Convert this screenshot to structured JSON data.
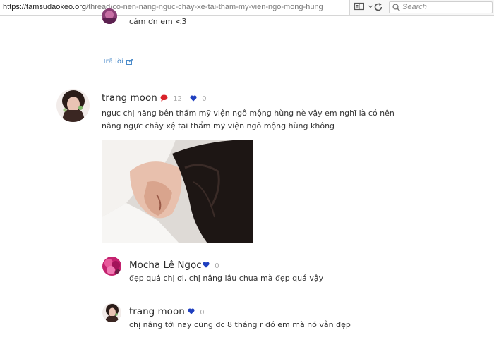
{
  "browser": {
    "url_host": "https://tamsudaokeo.org",
    "url_path": "/thread/co-nen-nang-nguc-chay-xe-tai-tham-my-vien-ngo-mong-hung",
    "search_placeholder": "Search"
  },
  "previous_reply": {
    "text": "cảm ơn em <3",
    "reply_label": "Trả lời"
  },
  "main_comment": {
    "author": "trang moon",
    "comment_count": "12",
    "like_count": "0",
    "text": "ngực chị năng bên thẩm mỹ viện ngô mộng hùng nè vậy em nghĩ là có nên nâng ngực chảy xệ tại thẩm mỹ viện ngô mộng hùng không"
  },
  "replies": [
    {
      "author": "Mocha Lê Ngọc",
      "like_count": "0",
      "text": "đẹp quá chị ơi, chị nâng lâu chưa mà đẹp quá vậy"
    },
    {
      "author": "trang moon",
      "like_count": "0",
      "text": "chị nâng tới nay cũng đc 8 tháng r đó em mà nó vẫn đẹp"
    }
  ],
  "colors": {
    "link": "#4a8ac9",
    "comment_icon": "#d9232a",
    "heart_icon": "#1f3fbf"
  }
}
